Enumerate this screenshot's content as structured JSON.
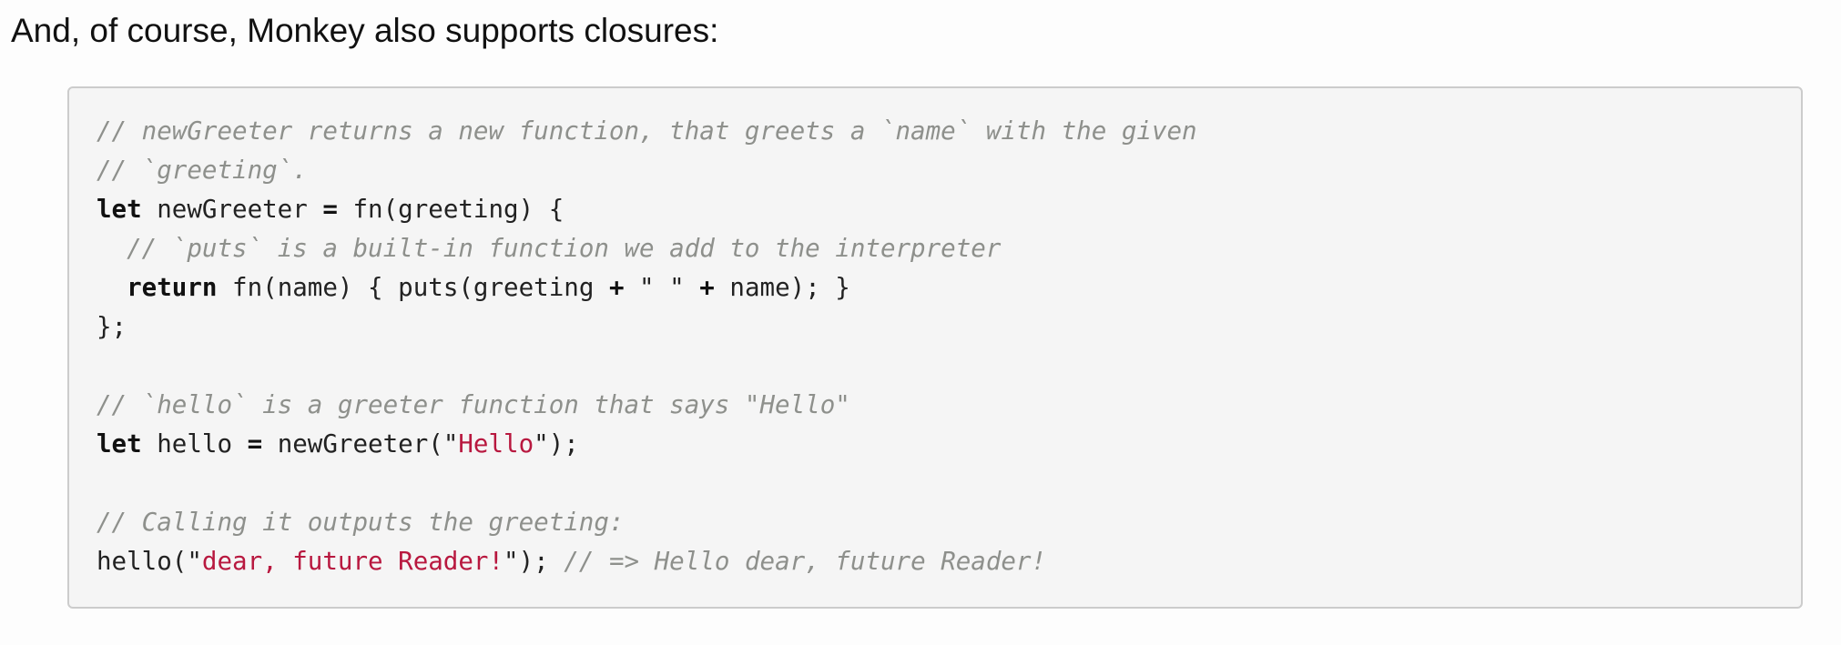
{
  "intro_text": "And, of course, Monkey also supports closures:",
  "colors": {
    "background": "#fdfdfd",
    "code_background": "#f5f5f5",
    "code_border": "#cccccc",
    "comment": "#8e908c",
    "string": "#b8183f",
    "keyword": "#111111",
    "text": "#222222"
  },
  "code_lines": [
    [
      {
        "t": "cm",
        "v": "// newGreeter returns a new function, that greets a `name` with the given"
      }
    ],
    [
      {
        "t": "cm",
        "v": "// `greeting`."
      }
    ],
    [
      {
        "t": "kw",
        "v": "let"
      },
      {
        "t": "plain",
        "v": " newGreeter "
      },
      {
        "t": "op",
        "v": "="
      },
      {
        "t": "plain",
        "v": " fn(greeting) {"
      }
    ],
    [
      {
        "t": "plain",
        "v": "  "
      },
      {
        "t": "cm",
        "v": "// `puts` is a built-in function we add to the interpreter"
      }
    ],
    [
      {
        "t": "plain",
        "v": "  "
      },
      {
        "t": "kw",
        "v": "return"
      },
      {
        "t": "plain",
        "v": " fn(name) { puts(greeting "
      },
      {
        "t": "op",
        "v": "+"
      },
      {
        "t": "plain",
        "v": " \" \" "
      },
      {
        "t": "op",
        "v": "+"
      },
      {
        "t": "plain",
        "v": " name); }"
      }
    ],
    [
      {
        "t": "plain",
        "v": "};"
      }
    ],
    [],
    [
      {
        "t": "cm",
        "v": "// `hello` is a greeter function that says \"Hello\""
      }
    ],
    [
      {
        "t": "kw",
        "v": "let"
      },
      {
        "t": "plain",
        "v": " hello "
      },
      {
        "t": "op",
        "v": "="
      },
      {
        "t": "plain",
        "v": " newGreeter(\""
      },
      {
        "t": "str",
        "v": "Hello"
      },
      {
        "t": "plain",
        "v": "\");"
      }
    ],
    [],
    [
      {
        "t": "cm",
        "v": "// Calling it outputs the greeting:"
      }
    ],
    [
      {
        "t": "plain",
        "v": "hello(\""
      },
      {
        "t": "str",
        "v": "dear, future Reader!"
      },
      {
        "t": "plain",
        "v": "\"); "
      },
      {
        "t": "cm",
        "v": "// => Hello dear, future Reader!"
      }
    ]
  ]
}
